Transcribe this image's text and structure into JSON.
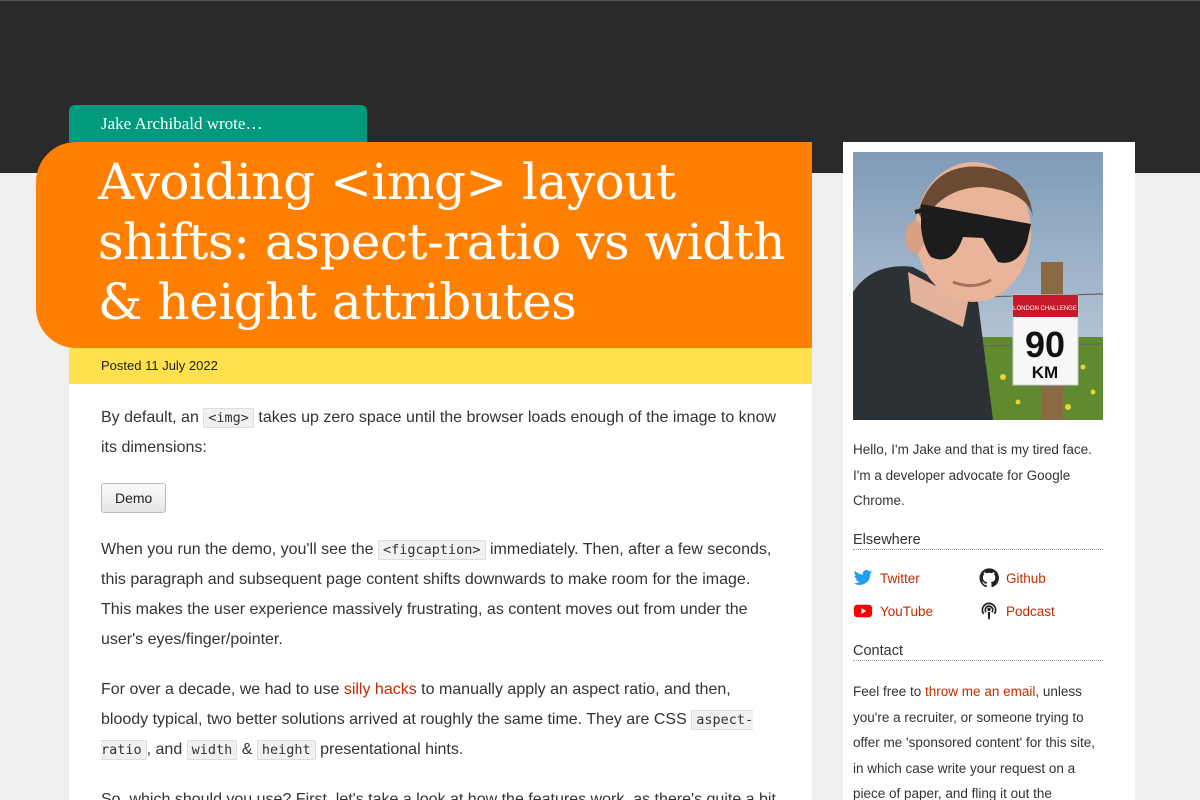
{
  "author_tab": {
    "text": "Jake Archibald wrote…"
  },
  "post": {
    "title": "Avoiding <img> layout shifts: aspect-ratio vs width & height attributes",
    "posted": "Posted 11 July 2022"
  },
  "article": {
    "p1_before": "By default, an ",
    "p1_code": "<img>",
    "p1_after": " takes up zero space until the browser loads enough of the image to know its dimensions:",
    "demo_button": "Demo",
    "p2_before": "When you run the demo, you'll see the ",
    "p2_code": "<figcaption>",
    "p2_after": " immediately. Then, after a few seconds, this paragraph and subsequent page content shifts downwards to make room for the image. This makes the user experience massively frustrating, as content moves out from under the user's eyes/finger/pointer.",
    "p3_before": "For over a decade, we had to use ",
    "p3_link": "silly hacks",
    "p3_mid": " to manually apply an aspect ratio, and then, bloody typical, two better solutions arrived at roughly the same time. They are CSS ",
    "p3_code1": "aspect-ratio",
    "p3_and": ", and ",
    "p3_code2": "width",
    "p3_amp": " & ",
    "p3_code3": "height",
    "p3_after": " presentational hints.",
    "p4": "So, which should you use? First, let's take a look at how the features work, as there's quite a bit"
  },
  "sidebar": {
    "bib_number": "90",
    "bib_unit": "KM",
    "bib_event": "LONDON CHALLENGE",
    "intro": "Hello, I'm Jake and that is my tired face. I'm a developer advocate for Google Chrome.",
    "elsewhere_heading": "Elsewhere",
    "links": {
      "twitter": "Twitter",
      "github": "Github",
      "youtube": "YouTube",
      "podcast": "Podcast"
    },
    "contact_heading": "Contact",
    "contact_before": "Feel free to ",
    "contact_link": "throw me an email",
    "contact_after": ", unless you're a recruiter, or someone trying to offer me 'sponsored content' for this site, in which case write your request on a piece of paper, and fling it out the"
  },
  "colors": {
    "header_bg": "#2a2a2a",
    "author_tab": "#009b7e",
    "title_bg": "#ff8000",
    "posted_bg": "#ffe14d",
    "link": "#c02c00",
    "twitter": "#1da1f2",
    "youtube": "#ff0000"
  }
}
